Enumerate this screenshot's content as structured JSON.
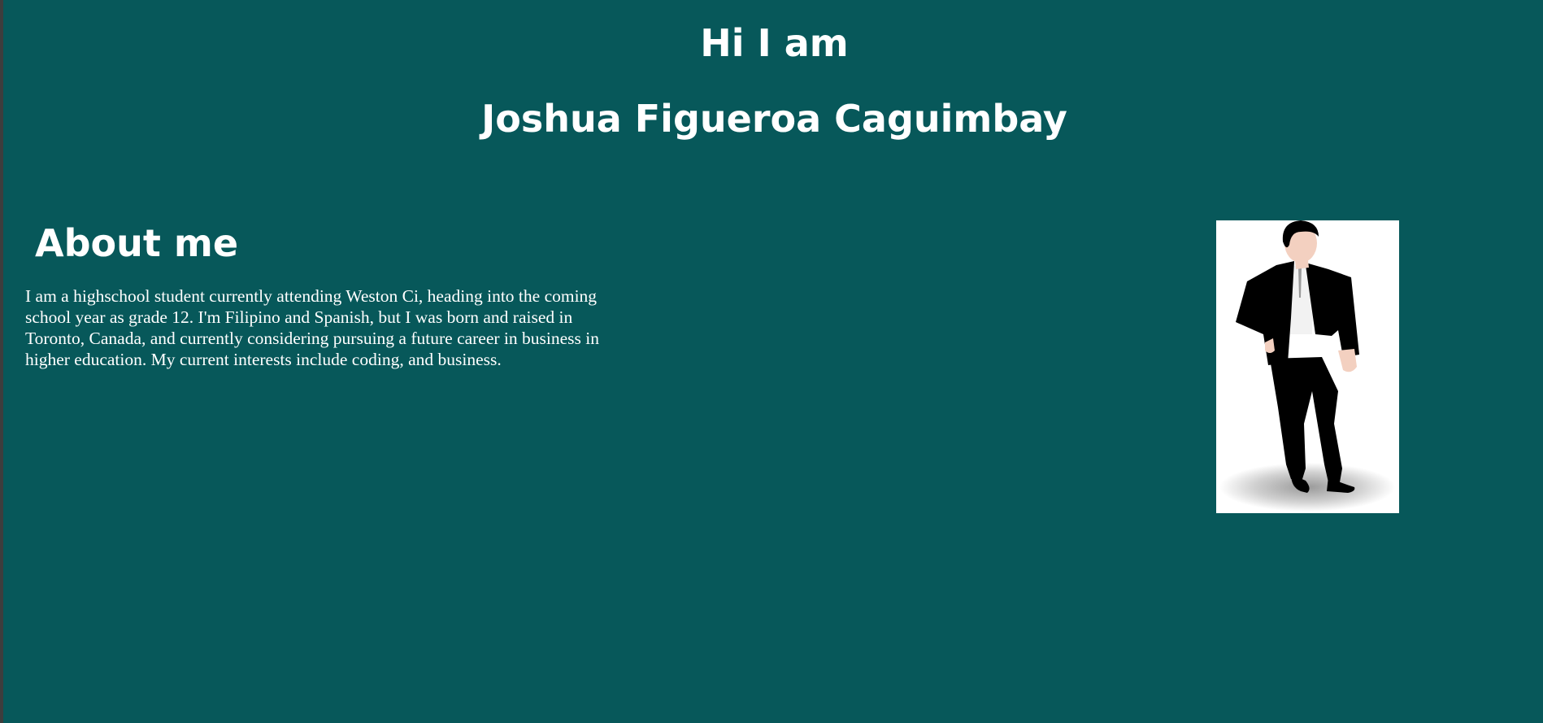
{
  "header": {
    "greeting": "Hi I am",
    "name": "Joshua Figueroa Caguimbay"
  },
  "about": {
    "heading": "About me",
    "text": "I am a highschool student currently attending Weston Ci, heading into the coming school year as grade 12. I'm Filipino and Spanish, but I was born and raised in Toronto, Canada, and currently considering pursuing a future career in business in higher education. My current interests include coding, and business."
  },
  "profile_image": {
    "icon": "man-in-suit-illustration"
  },
  "colors": {
    "background": "#07585a",
    "text": "#ffffff",
    "image_background": "#ffffff"
  }
}
